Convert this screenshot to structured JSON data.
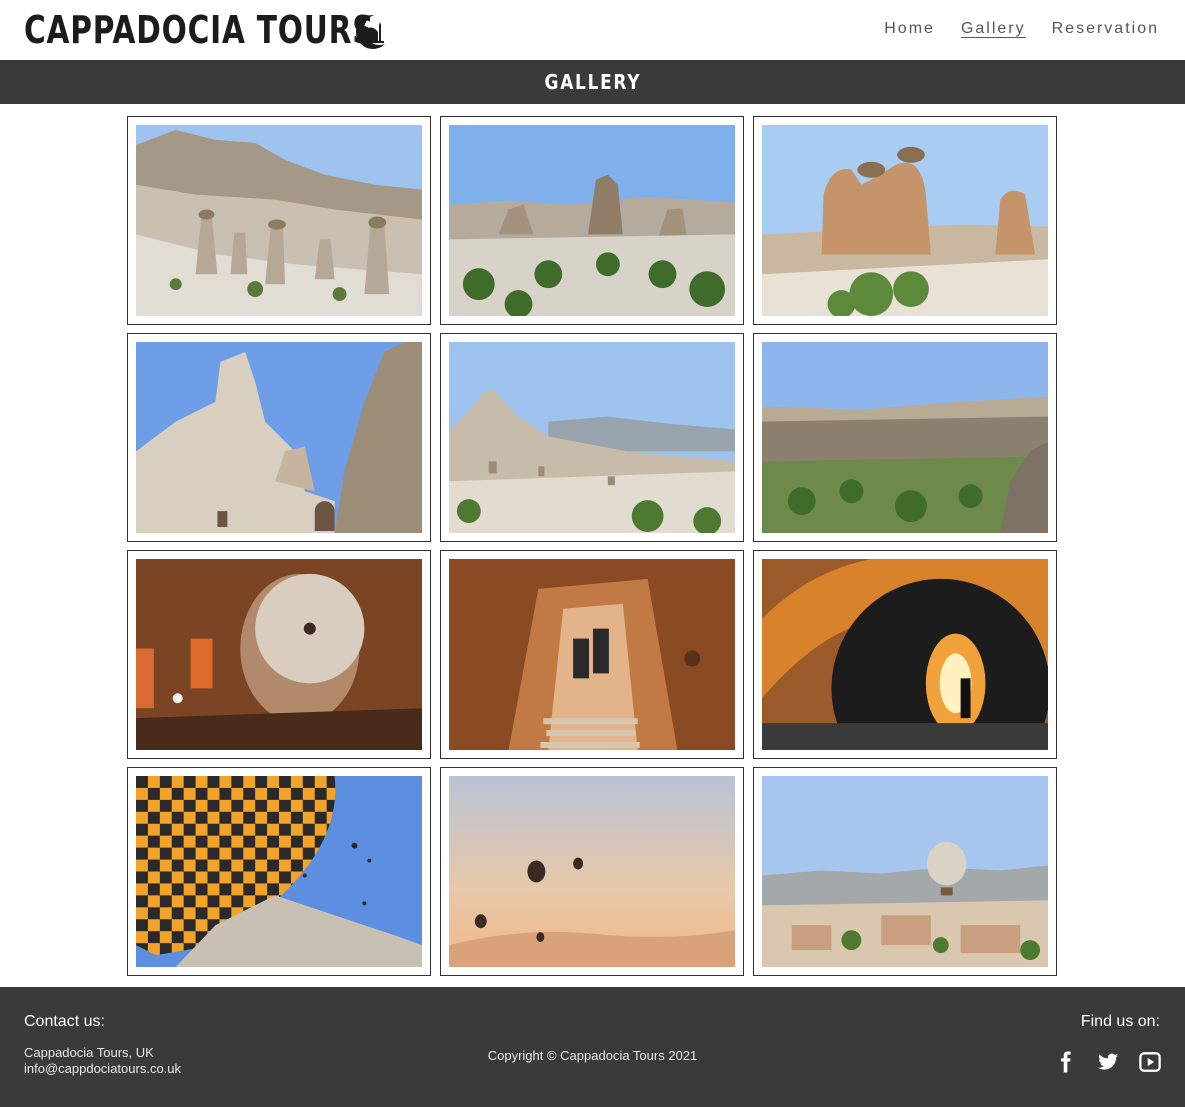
{
  "header": {
    "brand": "CAPPADOCIA TOURS",
    "logo_icon": "mosque-crescent-icon",
    "nav": [
      {
        "label": "Home",
        "active": false
      },
      {
        "label": "Gallery",
        "active": true
      },
      {
        "label": "Reservation",
        "active": false
      }
    ]
  },
  "banner": {
    "title": "GALLERY"
  },
  "gallery": {
    "photos": [
      {
        "scene": "fairy-chimneys-valley"
      },
      {
        "scene": "rock-formations-trees"
      },
      {
        "scene": "camel-rock"
      },
      {
        "scene": "cave-dwellings-rock"
      },
      {
        "scene": "uchisar-castle-town"
      },
      {
        "scene": "ihlara-valley"
      },
      {
        "scene": "underground-city-stone-door"
      },
      {
        "scene": "underground-tunnel-stairs"
      },
      {
        "scene": "balloon-burner-flame"
      },
      {
        "scene": "checkered-balloon-sky"
      },
      {
        "scene": "balloons-at-sunrise"
      },
      {
        "scene": "balloon-over-town"
      }
    ]
  },
  "footer": {
    "contact_title": "Contact us:",
    "contact_lines": [
      "Cappadocia Tours, UK",
      "info@cappdociatours.co.uk"
    ],
    "copyright": "Copyright © Cappadocia Tours 2021",
    "find_title": "Find us on:",
    "social": [
      {
        "icon": "facebook-icon"
      },
      {
        "icon": "twitter-icon"
      },
      {
        "icon": "youtube-icon"
      }
    ]
  },
  "colors": {
    "header_bg": "#ffffff",
    "banner_bg": "#3a3a3a",
    "footer_bg": "#3a3a3a",
    "brand_text": "#1c1c1c",
    "nav_text": "#555555"
  }
}
